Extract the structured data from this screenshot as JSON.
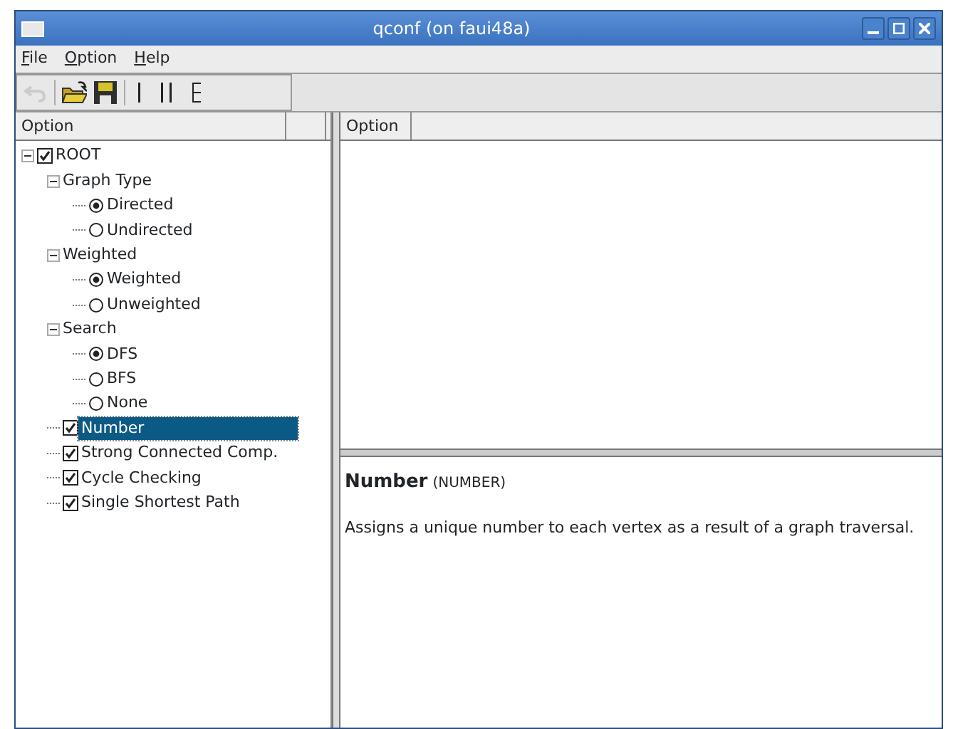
{
  "window": {
    "title": "qconf (on faui48a)"
  },
  "menu": [
    "File",
    "Option",
    "Help"
  ],
  "toolbar": [
    {
      "kind": "undo",
      "disabled": true
    },
    {
      "kind": "open",
      "disabled": false
    },
    {
      "kind": "save",
      "disabled": false
    },
    {
      "kind": "single",
      "disabled": false
    },
    {
      "kind": "split",
      "disabled": false
    },
    {
      "kind": "full",
      "disabled": false
    }
  ],
  "tree": {
    "header": "Option",
    "items": [
      {
        "label": "ROOT",
        "kind": "checkbox",
        "checked": true,
        "selected": false,
        "expanded": true,
        "children": [
          {
            "label": "Graph Type",
            "kind": "group",
            "selected": false,
            "expanded": true,
            "children": [
              {
                "label": "Directed",
                "kind": "radio",
                "checked": true,
                "selected": false
              },
              {
                "label": "Undirected",
                "kind": "radio",
                "checked": false,
                "selected": false
              }
            ]
          },
          {
            "label": "Weighted",
            "kind": "group",
            "selected": false,
            "expanded": true,
            "children": [
              {
                "label": "Weighted",
                "kind": "radio",
                "checked": true,
                "selected": false
              },
              {
                "label": "Unweighted",
                "kind": "radio",
                "checked": false,
                "selected": false
              }
            ]
          },
          {
            "label": "Search",
            "kind": "group",
            "selected": false,
            "expanded": true,
            "children": [
              {
                "label": "DFS",
                "kind": "radio",
                "checked": true,
                "selected": false
              },
              {
                "label": "BFS",
                "kind": "radio",
                "checked": false,
                "selected": false
              },
              {
                "label": "None",
                "kind": "radio",
                "checked": false,
                "selected": false
              }
            ]
          },
          {
            "label": "Number",
            "kind": "checkbox",
            "checked": true,
            "selected": true
          },
          {
            "label": "Strong Connected Comp.",
            "kind": "checkbox",
            "checked": true,
            "selected": false
          },
          {
            "label": "Cycle Checking",
            "kind": "checkbox",
            "checked": true,
            "selected": false
          },
          {
            "label": "Single Shortest Path",
            "kind": "checkbox",
            "checked": true,
            "selected": false
          }
        ]
      }
    ]
  },
  "list": {
    "header": "Option"
  },
  "help": {
    "title": "Number",
    "symbol": "(NUMBER)",
    "text": "Assigns a unique number to each vertex as a result of a graph traversal."
  }
}
